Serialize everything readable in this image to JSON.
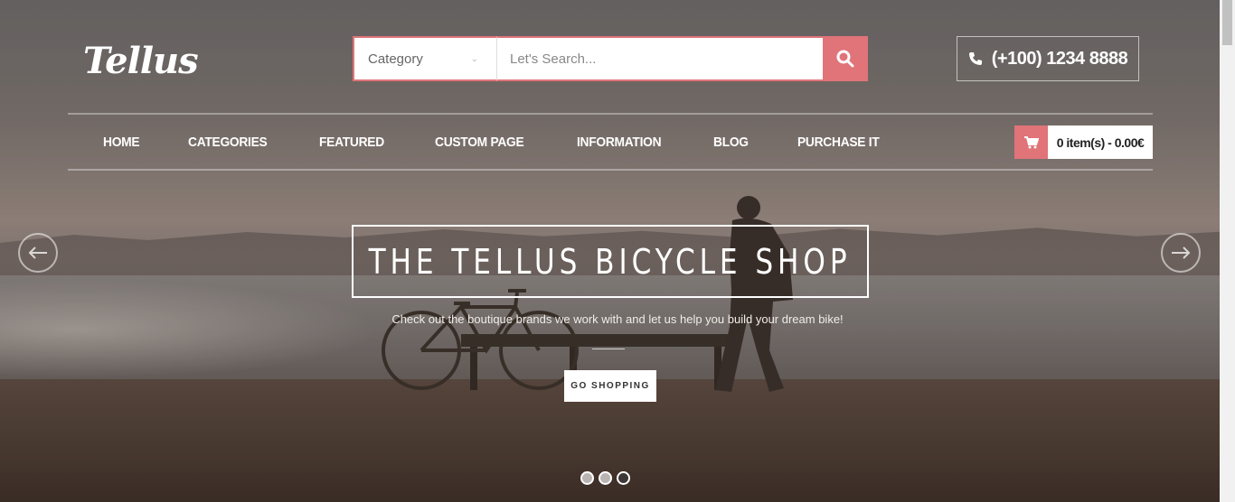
{
  "brand": {
    "logo_text": "Tellus",
    "accent_color": "#e07479"
  },
  "search": {
    "category_label": "Category",
    "placeholder": "Let's Search...",
    "button_icon": "search-icon"
  },
  "contact": {
    "phone": "(+100) 1234 8888",
    "icon": "phone-icon"
  },
  "nav": {
    "items": [
      {
        "label": "HOME"
      },
      {
        "label": "CATEGORIES"
      },
      {
        "label": "FEATURED"
      },
      {
        "label": "CUSTOM PAGE"
      },
      {
        "label": "INFORMATION"
      },
      {
        "label": "BLOG"
      },
      {
        "label": "PURCHASE IT"
      }
    ]
  },
  "cart": {
    "summary": "0 item(s) - 0.00€",
    "icon": "cart-icon"
  },
  "slider": {
    "title": "THE TELLUS BICYCLE SHOP",
    "subtitle": "Check out the boutique brands we work with and let us help you build your dream bike!",
    "cta_label": "GO SHOPPING",
    "prev_icon": "arrow-left-icon",
    "next_icon": "arrow-right-icon",
    "slide_count": 3,
    "active_slide": 3
  }
}
